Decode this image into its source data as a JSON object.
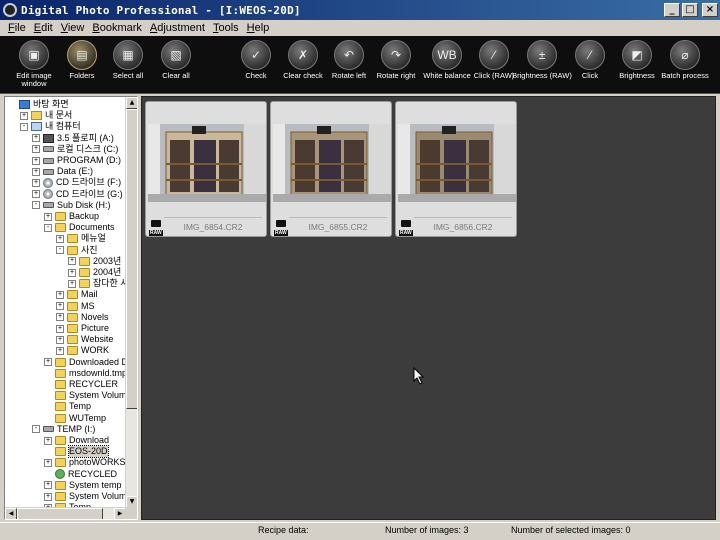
{
  "window": {
    "title": "Digital Photo Professional - [I:WEOS-20D]",
    "minimize": "_",
    "maximize": "□",
    "close": "×"
  },
  "menu": [
    "File",
    "Edit",
    "View",
    "Bookmark",
    "Adjustment",
    "Tools",
    "Help"
  ],
  "toolbar": [
    {
      "label": "Edit image window",
      "icon": "edit-image-icon",
      "glyph": "▣"
    },
    {
      "label": "Folders",
      "icon": "folders-icon",
      "glyph": "▤"
    },
    {
      "label": "Select all",
      "icon": "select-all-icon",
      "glyph": "▦"
    },
    {
      "label": "Clear all",
      "icon": "clear-all-icon",
      "glyph": "▧"
    },
    {
      "label": "Check",
      "icon": "check-icon",
      "glyph": "✓"
    },
    {
      "label": "Clear check",
      "icon": "clear-check-icon",
      "glyph": "✗"
    },
    {
      "label": "Rotate left",
      "icon": "rotate-left-icon",
      "glyph": "↶"
    },
    {
      "label": "Rotate right",
      "icon": "rotate-right-icon",
      "glyph": "↷"
    },
    {
      "label": "White balance",
      "icon": "white-balance-icon",
      "glyph": "WB"
    },
    {
      "label": "Click (RAW)",
      "icon": "eyedropper-raw-icon",
      "glyph": "⁄"
    },
    {
      "label": "Brightness (RAW)",
      "icon": "brightness-raw-icon",
      "glyph": "±"
    },
    {
      "label": "Click",
      "icon": "eyedropper-icon",
      "glyph": "⁄"
    },
    {
      "label": "Brightness",
      "icon": "brightness-icon",
      "glyph": "◩"
    },
    {
      "label": "Batch process",
      "icon": "batch-process-icon",
      "glyph": "⌀"
    }
  ],
  "tree": [
    {
      "label": "바탕 화면",
      "icon": "desktop",
      "depth": 0,
      "exp": ""
    },
    {
      "label": "내 문서",
      "icon": "docs",
      "depth": 1,
      "exp": "+"
    },
    {
      "label": "내 컴퓨터",
      "icon": "computer",
      "depth": 1,
      "exp": "-"
    },
    {
      "label": "3.5 플로피 (A:)",
      "icon": "floppy",
      "depth": 2,
      "exp": "+"
    },
    {
      "label": "로컬 디스크 (C:)",
      "icon": "drive",
      "depth": 2,
      "exp": "+"
    },
    {
      "label": "PROGRAM (D:)",
      "icon": "drive",
      "depth": 2,
      "exp": "+"
    },
    {
      "label": "Data (E:)",
      "icon": "drive",
      "depth": 2,
      "exp": "+"
    },
    {
      "label": "CD 드라이브 (F:)",
      "icon": "cd",
      "depth": 2,
      "exp": "+"
    },
    {
      "label": "CD 드라이브 (G:)",
      "icon": "cd",
      "depth": 2,
      "exp": "+"
    },
    {
      "label": "Sub Disk (H:)",
      "icon": "drive",
      "depth": 2,
      "exp": "-"
    },
    {
      "label": "Backup",
      "icon": "folder",
      "depth": 3,
      "exp": "+"
    },
    {
      "label": "Documents",
      "icon": "folder",
      "depth": 3,
      "exp": "-"
    },
    {
      "label": "메뉴얼",
      "icon": "folder",
      "depth": 4,
      "exp": "+"
    },
    {
      "label": "사진",
      "icon": "folder",
      "depth": 4,
      "exp": "-"
    },
    {
      "label": "2003년",
      "icon": "folder",
      "depth": 5,
      "exp": "+"
    },
    {
      "label": "2004년",
      "icon": "folder",
      "depth": 5,
      "exp": "+"
    },
    {
      "label": "잡다한 사",
      "icon": "folder",
      "depth": 5,
      "exp": "+"
    },
    {
      "label": "Mail",
      "icon": "folder",
      "depth": 4,
      "exp": "+"
    },
    {
      "label": "MS",
      "icon": "folder",
      "depth": 4,
      "exp": "+"
    },
    {
      "label": "Novels",
      "icon": "folder",
      "depth": 4,
      "exp": "+"
    },
    {
      "label": "Picture",
      "icon": "folder",
      "depth": 4,
      "exp": "+"
    },
    {
      "label": "Website",
      "icon": "folder",
      "depth": 4,
      "exp": "+"
    },
    {
      "label": "WORK",
      "icon": "folder",
      "depth": 4,
      "exp": "+"
    },
    {
      "label": "Downloaded Da",
      "icon": "folder",
      "depth": 3,
      "exp": "+"
    },
    {
      "label": "msdownld.tmp",
      "icon": "folder",
      "depth": 3,
      "exp": ""
    },
    {
      "label": "RECYCLER",
      "icon": "folder",
      "depth": 3,
      "exp": ""
    },
    {
      "label": "System Volume",
      "icon": "folder",
      "depth": 3,
      "exp": ""
    },
    {
      "label": "Temp",
      "icon": "folder",
      "depth": 3,
      "exp": ""
    },
    {
      "label": "WUTemp",
      "icon": "folder",
      "depth": 3,
      "exp": ""
    },
    {
      "label": "TEMP (I:)",
      "icon": "drive",
      "depth": 2,
      "exp": "-"
    },
    {
      "label": "Download",
      "icon": "folder",
      "depth": 3,
      "exp": "+"
    },
    {
      "label": "EOS-20D",
      "icon": "folder",
      "depth": 3,
      "exp": "",
      "selected": true
    },
    {
      "label": "photoWORKS Te",
      "icon": "folder",
      "depth": 3,
      "exp": "+"
    },
    {
      "label": "RECYCLED",
      "icon": "recyc",
      "depth": 3,
      "exp": ""
    },
    {
      "label": "System temp",
      "icon": "folder",
      "depth": 3,
      "exp": "+"
    },
    {
      "label": "System Volume",
      "icon": "folder",
      "depth": 3,
      "exp": "+"
    },
    {
      "label": "Temp",
      "icon": "folder",
      "depth": 3,
      "exp": "+"
    }
  ],
  "thumbnails": [
    {
      "filename": "IMG_6854.CR2",
      "badge": "RAW",
      "tint": "#c9b89a"
    },
    {
      "filename": "IMG_6855.CR2",
      "badge": "RAW",
      "tint": "#a8967a"
    },
    {
      "filename": "IMG_6856.CR2",
      "badge": "RAW",
      "tint": "#9a8a70"
    }
  ],
  "status": {
    "recipe_label": "Recipe data:",
    "images_label": "Number of images: 3",
    "selected_label": "Number of selected images: 0"
  }
}
